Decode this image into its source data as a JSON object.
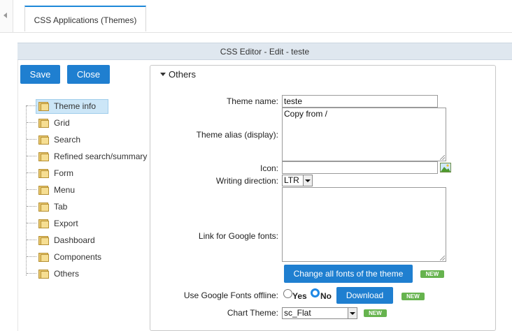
{
  "tabs": [
    {
      "label": "CSS Applications (Themes)"
    }
  ],
  "editor": {
    "title": "CSS Editor - Edit - teste"
  },
  "actions": {
    "save": "Save",
    "close": "Close"
  },
  "tree": {
    "items": [
      {
        "label": "Theme info",
        "selected": true
      },
      {
        "label": "Grid"
      },
      {
        "label": "Search"
      },
      {
        "label": "Refined search/summary"
      },
      {
        "label": "Form"
      },
      {
        "label": "Menu"
      },
      {
        "label": "Tab"
      },
      {
        "label": "Export"
      },
      {
        "label": "Dashboard"
      },
      {
        "label": "Components"
      },
      {
        "label": "Others"
      }
    ]
  },
  "panel": {
    "title": "Others",
    "theme_name": {
      "label": "Theme name:",
      "value": "teste"
    },
    "theme_alias": {
      "label": "Theme alias (display):",
      "value": "Copy from /"
    },
    "icon": {
      "label": "Icon:",
      "value": ""
    },
    "writing_direction": {
      "label": "Writing direction:",
      "value": "LTR"
    },
    "google_fonts_link": {
      "label": "Link for Google fonts:",
      "value": ""
    },
    "change_fonts_button": "Change all fonts of the theme",
    "new_badge": "NEW",
    "google_fonts_offline": {
      "label": "Use Google Fonts offline:",
      "yes": "Yes",
      "no": "No",
      "selected": "No"
    },
    "download_button": "Download",
    "chart_theme": {
      "label": "Chart Theme:",
      "value": "sc_Flat"
    }
  },
  "colors": {
    "accent": "#1f7fd0",
    "badge": "#66b34e",
    "header_bg": "#dfe7ef"
  }
}
